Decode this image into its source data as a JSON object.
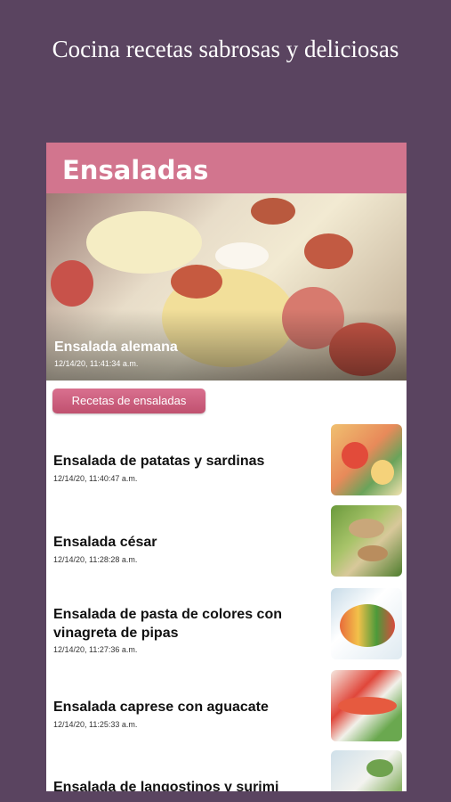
{
  "banner": {
    "text": "Cocina recetas sabrosas y deliciosas"
  },
  "header": {
    "title": "Ensaladas"
  },
  "hero": {
    "title": "Ensalada alemana",
    "date": "12/14/20, 11:41:34 a.m."
  },
  "chip": {
    "label": "Recetas de ensaladas"
  },
  "items": [
    {
      "title": "Ensalada de patatas y sardinas",
      "date": "12/14/20, 11:40:47 a.m."
    },
    {
      "title": "Ensalada césar",
      "date": "12/14/20, 11:28:28 a.m."
    },
    {
      "title": "Ensalada de pasta de colores con vinagreta de pipas",
      "date": "12/14/20, 11:27:36 a.m."
    },
    {
      "title": "Ensalada caprese con aguacate",
      "date": "12/14/20, 11:25:33 a.m."
    },
    {
      "title": "Ensalada de langostinos y surimi",
      "date": ""
    }
  ],
  "colors": {
    "background": "#5a4460",
    "header": "#d2758e",
    "chip": "#c9607f"
  }
}
